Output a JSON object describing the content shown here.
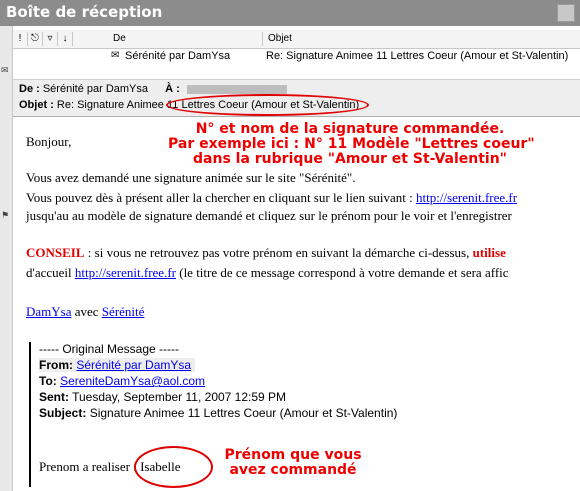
{
  "window": {
    "title": "Boîte de réception"
  },
  "columns": {
    "de": "De",
    "objet": "Objet"
  },
  "message_list": {
    "from": "Sérénité par DamYsa",
    "subject": "Re: Signature Animee 11 Lettres Coeur (Amour et St-Valentin)"
  },
  "header": {
    "de_label": "De :",
    "de_value": "Sérénité par DamYsa",
    "a_label": "À :",
    "objet_label": "Objet :",
    "objet_value": "Re: Signature Animee 11 Lettres Coeur (Amour et St-Valentin)"
  },
  "body": {
    "greeting": "Bonjour,",
    "p1": "Vous avez demandé une signature animée sur le site \"Sérénité\".",
    "p2_text": "Vous pouvez dès à présent aller la chercher en cliquant sur le lien suivant : ",
    "p2_link": "http://serenit.free.fr",
    "p3": "jusqu'au au modèle de signature demandé et cliquez sur le prénom pour le voir et l'enregistrer",
    "conseil_label": "CONSEIL",
    "conseil_text": " : si vous ne retrouvez pas votre prénom en suivant la démarche ci-dessus, ",
    "conseil_red": "utilise",
    "accueil_text": "d'accueil ",
    "accueil_link": "http://serenit.free.fr",
    "accueil_rest": " (le titre de ce message correspond à votre demande et sera affic",
    "sig_link1": "DamYsa",
    "sig_mid": " avec ",
    "sig_link2": "Sérénité"
  },
  "quote": {
    "original": "----- Original Message -----",
    "from_label": "From:",
    "from_value": "Sérénité par DamYsa",
    "to_label": "To:",
    "to_value": "SereniteDamYsa@aol.com",
    "sent_label": "Sent:",
    "sent_value": "Tuesday, September 11, 2007 12:59 PM",
    "subject_label": "Subject:",
    "subject_value": "Signature Animee 11 Lettres Coeur (Amour et St-Valentin)",
    "prenom_label": "Prenom a realiser : ",
    "prenom_value": "Isabelle"
  },
  "annotations": {
    "a1_line1": "N° et nom de la signature commandée.",
    "a1_line2": "Par exemple ici : N° 11 Modèle \"Lettres coeur\"",
    "a1_line3": "dans la rubrique \"Amour et St-Valentin\"",
    "a2_line1": "Prénom que vous",
    "a2_line2": "avez commandé"
  },
  "colors": {
    "annotation": "#e00000",
    "link": "#0000ee",
    "titlebar": "#8c8c8c"
  }
}
